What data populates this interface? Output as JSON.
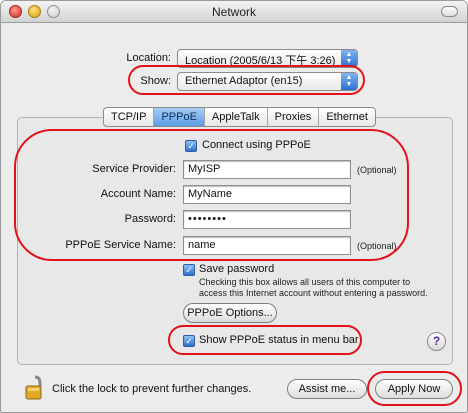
{
  "window": {
    "title": "Network"
  },
  "location": {
    "label": "Location:",
    "value": "Location (2005/6/13 下午 3:26)"
  },
  "show": {
    "label": "Show:",
    "value": "Ethernet Adaptor (en15)"
  },
  "tabs": [
    {
      "label": "TCP/IP",
      "active": false
    },
    {
      "label": "PPPoE",
      "active": true
    },
    {
      "label": "AppleTalk",
      "active": false
    },
    {
      "label": "Proxies",
      "active": false
    },
    {
      "label": "Ethernet",
      "active": false
    }
  ],
  "pppoe": {
    "connect_label": "Connect using PPPoE",
    "connect_checked": true,
    "service_provider": {
      "label": "Service Provider:",
      "value": "MyISP",
      "note": "(Optional)"
    },
    "account_name": {
      "label": "Account Name:",
      "value": "MyName"
    },
    "password": {
      "label": "Password:",
      "value": "••••••••"
    },
    "service_name": {
      "label": "PPPoE Service Name:",
      "value": "name",
      "note": "(Optional)"
    },
    "save_password_label": "Save password",
    "save_password_checked": true,
    "save_password_hint_1": "Checking this box allows all users of this computer to",
    "save_password_hint_2": "access this Internet account without entering a password.",
    "options_button": "PPPoE Options...",
    "status_menu_label": "Show PPPoE status in menu bar",
    "status_menu_checked": true,
    "help_label": "?"
  },
  "footer": {
    "lock_text": "Click the lock to prevent further changes.",
    "assist_button": "Assist me...",
    "apply_button": "Apply Now"
  },
  "colors": {
    "annotation": "#e3111b",
    "accent": "#3b82dd"
  }
}
